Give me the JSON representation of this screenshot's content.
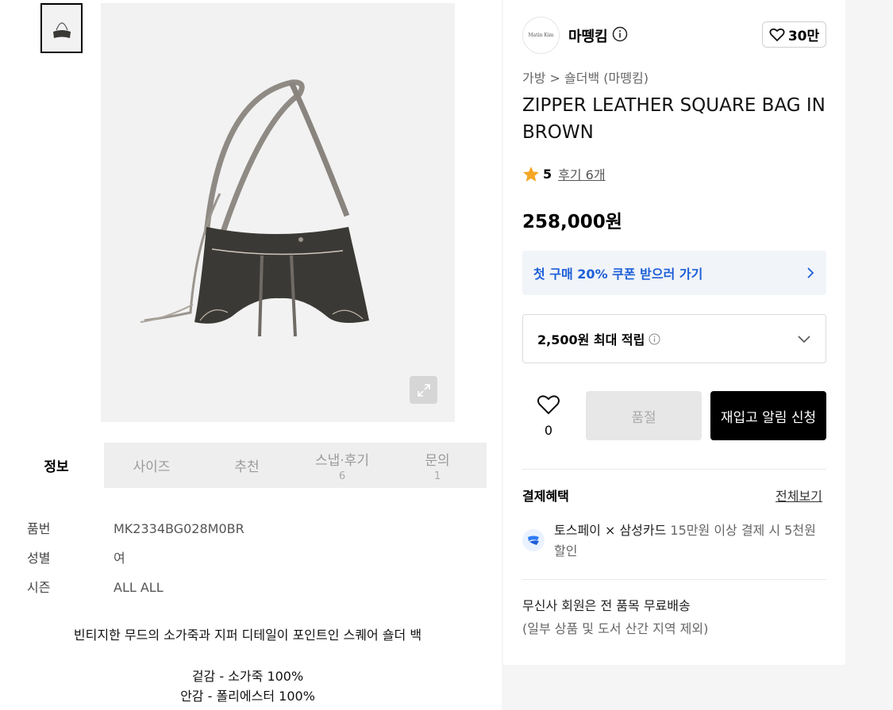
{
  "gallery": {
    "expand_icon": "expand-icon"
  },
  "tabs": [
    {
      "label": "정보",
      "count": ""
    },
    {
      "label": "사이즈",
      "count": ""
    },
    {
      "label": "추천",
      "count": ""
    },
    {
      "label": "스냅·후기",
      "count": "6"
    },
    {
      "label": "문의",
      "count": "1"
    }
  ],
  "info": {
    "rows": [
      {
        "key": "품번",
        "value": "MK2334BG028M0BR"
      },
      {
        "key": "성별",
        "value": "여"
      },
      {
        "key": "시즌",
        "value": "ALL ALL"
      }
    ],
    "description": "빈티지한 무드의 소가죽과 지퍼 디테일이 포인트인 스퀘어 숄더 백",
    "material_outer": "겉감 - 소가죽 100%",
    "material_inner": "안감 - 폴리에스터 100%"
  },
  "product": {
    "brand_logo_text": "Matin Kim",
    "brand_name": "마뗑킴",
    "likes": "30만",
    "breadcrumb_1": "가방",
    "breadcrumb_sep": ">",
    "breadcrumb_2": "숄더백 (마뗑킴)",
    "title": "ZIPPER LEATHER SQUARE BAG IN BROWN",
    "rating": "5",
    "reviews": "후기 6개",
    "price": "258,000원",
    "coupon": "첫 구매 20% 쿠폰 받으러 가기",
    "points": "2,500원 최대 적립",
    "wish_count": "0",
    "soldout_label": "품절",
    "restock_label": "재입고 알림 신청"
  },
  "benefits": {
    "title": "결제혜택",
    "see_all": "전체보기",
    "card_name": "토스페이 × 삼성카드",
    "card_desc": " 15만원 이상 결제 시 5천원 할인",
    "shipping": "무신사 회원은 전 품목 무료배송",
    "shipping_note": "(일부 상품 및 도서 산간 지역 제외)"
  },
  "colors": {
    "accent_blue": "#1c5fd8",
    "star": "#f5a623",
    "button_black": "#000000"
  }
}
